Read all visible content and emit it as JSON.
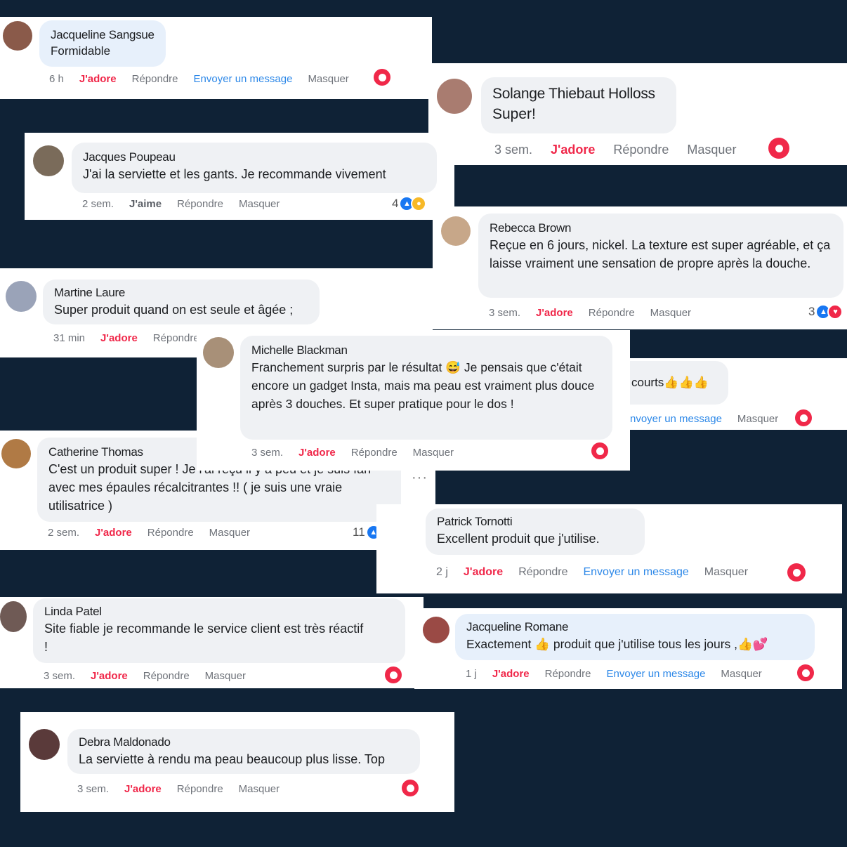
{
  "colors": {
    "background": "#0f2236",
    "love": "#f0284a",
    "link": "#2d88e8"
  },
  "comments": [
    {
      "id": "c1",
      "name": "Jacqueline Sangsue",
      "text": "Formidable",
      "time": "6 h",
      "react": "J'adore",
      "reply": "Répondre",
      "message": "Envoyer un message",
      "hide": "Masquer"
    },
    {
      "id": "c2",
      "name": "Solange Thiebaut Holloss",
      "text": "Super!",
      "time": "3 sem.",
      "react": "J'adore",
      "reply": "Répondre",
      "hide": "Masquer"
    },
    {
      "id": "c3",
      "name": "Jacques Poupeau",
      "text": "J'ai la serviette et les gants. Je recommande vivement",
      "time": "2 sem.",
      "react": "J'aime",
      "reply": "Répondre",
      "hide": "Masquer",
      "reaction_count": "4"
    },
    {
      "id": "c4",
      "name": "Rebecca Brown",
      "text": "Reçue en 6 jours, nickel. La texture est super agréable, et ça laisse vraiment une sensation de propre après la douche.",
      "time": "3 sem.",
      "react": "J'adore",
      "reply": "Répondre",
      "hide": "Masquer",
      "reaction_count": "3"
    },
    {
      "id": "c5",
      "name": "Martine Laure",
      "text": "Super produit quand on est seule et âgée ;",
      "time": "31 min",
      "react": "J'adore",
      "reply": "Répondre"
    },
    {
      "id": "c6",
      "name": "Michelle Blackman",
      "text": "Franchement surpris par le résultat 😅 Je pensais que c'était encore un gadget Insta, mais ma peau est vraiment plus douce après 3 douches. Et super pratique pour le dos !",
      "time": "3 sem.",
      "react": "J'adore",
      "reply": "Répondre",
      "hide": "Masquer"
    },
    {
      "id": "c7",
      "text": "courts👍👍👍",
      "message": "nvoyer un message",
      "hide": "Masquer"
    },
    {
      "id": "c8",
      "name": "Catherine Thomas",
      "text": "C'est un produit super ! Je l'ai reçu il y a peu et je suis fan avec mes épaules récalcitrantes !! ( je suis une vraie utilisatrice )",
      "time": "2 sem.",
      "react": "J'adore",
      "reply": "Répondre",
      "hide": "Masquer",
      "reaction_count": "11"
    },
    {
      "id": "c9",
      "name": "Patrick Tornotti",
      "text": "Excellent produit que j'utilise.",
      "time": "2 j",
      "react": "J'adore",
      "reply": "Répondre",
      "message": "Envoyer un message",
      "hide": "Masquer"
    },
    {
      "id": "c10",
      "name": "Linda Patel",
      "text": "Site fiable je recommande le service client est très réactif !",
      "time": "3 sem.",
      "react": "J'adore",
      "reply": "Répondre",
      "hide": "Masquer"
    },
    {
      "id": "c11",
      "name": "Jacqueline Romane",
      "text": "Exactement 👍 produit que j'utilise tous les jours ,👍💕",
      "time": "1 j",
      "react": "J'adore",
      "reply": "Répondre",
      "message": "Envoyer un message",
      "hide": "Masquer"
    },
    {
      "id": "c12",
      "name": "Debra Maldonado",
      "text": "La serviette à rendu ma peau beaucoup plus lisse. Top",
      "time": "3 sem.",
      "react": "J'adore",
      "reply": "Répondre",
      "hide": "Masquer"
    }
  ]
}
